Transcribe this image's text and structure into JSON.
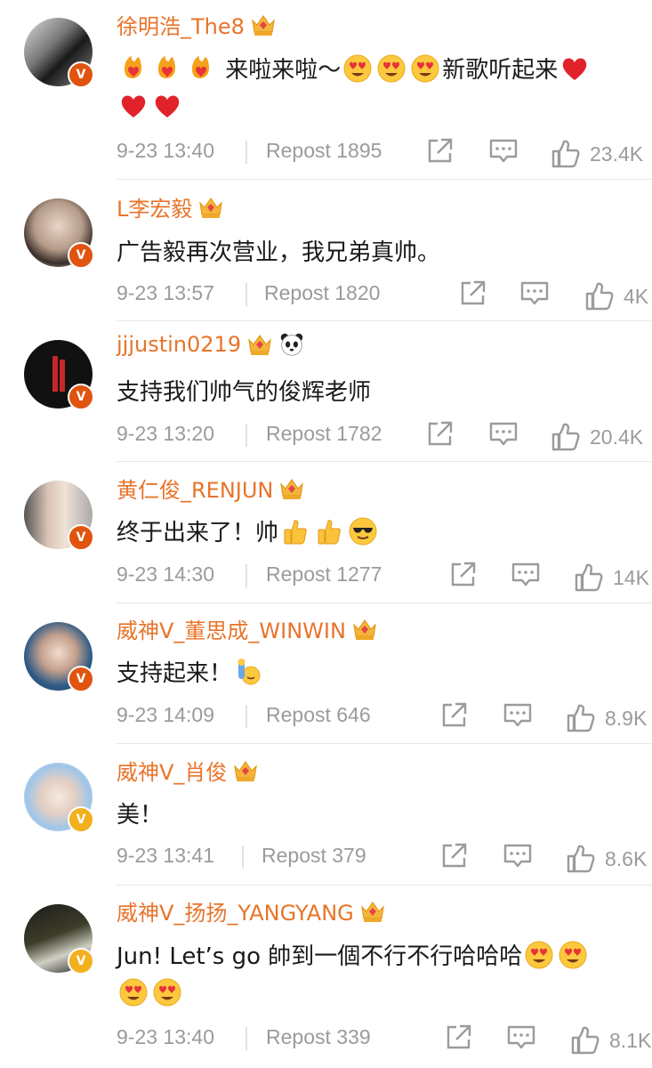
{
  "comments": [
    {
      "username": "徐明浩_The8",
      "badge": "orange",
      "text": "来啦来啦～",
      "text2": "新歌听起来",
      "time": "9-23 13:40",
      "repost": "Repost 1895",
      "likes": "23.4K"
    },
    {
      "username": "L李宏毅",
      "badge": "orange",
      "text": "广告毅再次营业，我兄弟真帅。",
      "time": "9-23 13:57",
      "repost": "Repost 1820",
      "likes": "4K"
    },
    {
      "username": "jjjustin0219",
      "badge": "orange",
      "text": "支持我们帅气的俊辉老师",
      "time": "9-23 13:20",
      "repost": "Repost 1782",
      "likes": "20.4K"
    },
    {
      "username": "黄仁俊_RENJUN",
      "badge": "orange",
      "text": "终于出来了！帅",
      "time": "9-23 14:30",
      "repost": "Repost 1277",
      "likes": "14K"
    },
    {
      "username": "威神V_董思成_WINWIN",
      "badge": "orange",
      "text": "支持起来！",
      "time": "9-23 14:09",
      "repost": "Repost 646",
      "likes": "8.9K"
    },
    {
      "username": "威神V_肖俊",
      "badge": "yellow",
      "text": "美！",
      "time": "9-23 13:41",
      "repost": "Repost 379",
      "likes": "8.6K"
    },
    {
      "username": "威神V_扬扬_YANGYANG",
      "badge": "yellow",
      "text": "Jun! Let’s go 帥到一個不行不行哈哈哈",
      "time": "9-23 13:40",
      "repost": "Repost 339",
      "likes": "8.1K"
    }
  ],
  "icons": {
    "badge": "verified-v-icon",
    "crown": "crown-icon",
    "share": "share-icon",
    "reply": "comment-icon",
    "like": "thumbs-up-icon"
  },
  "colors": {
    "username": "#e8742a",
    "meta": "#9b9b9b",
    "badge_orange": "#e0540f",
    "badge_yellow": "#f2b01e"
  }
}
